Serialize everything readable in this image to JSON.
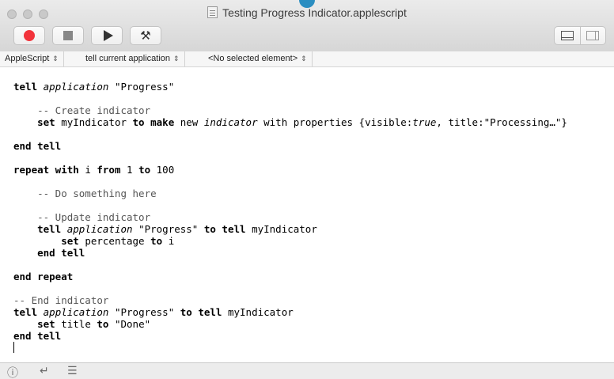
{
  "window": {
    "title": "Testing Progress Indicator.applescript"
  },
  "toolbar": {
    "record": "record",
    "stop": "stop",
    "run": "run",
    "compile": "compile",
    "show_bottom_pane": "show-bottom-pane",
    "show_right_pane": "show-right-pane"
  },
  "navbar": {
    "language": "AppleScript",
    "target": "tell current application",
    "element": "<No selected element>"
  },
  "code": {
    "lines": [
      [
        [
          "kw",
          "tell"
        ],
        [
          "t",
          " "
        ],
        [
          "app",
          "application"
        ],
        [
          "t",
          " \"Progress\""
        ]
      ],
      [],
      [
        [
          "cm",
          "    -- Create indicator"
        ]
      ],
      [
        [
          "t",
          "    "
        ],
        [
          "kw",
          "set"
        ],
        [
          "t",
          " myIndicator "
        ],
        [
          "kw",
          "to"
        ],
        [
          "t",
          " "
        ],
        [
          "kw",
          "make"
        ],
        [
          "t",
          " new "
        ],
        [
          "app",
          "indicator"
        ],
        [
          "t",
          " with properties {visible:"
        ],
        [
          "app",
          "true"
        ],
        [
          "t",
          ", title:\"Processing…\"}"
        ]
      ],
      [],
      [
        [
          "kw",
          "end tell"
        ]
      ],
      [],
      [
        [
          "kw",
          "repeat with"
        ],
        [
          "t",
          " i "
        ],
        [
          "kw",
          "from"
        ],
        [
          "t",
          " 1 "
        ],
        [
          "kw",
          "to"
        ],
        [
          "t",
          " 100"
        ]
      ],
      [],
      [
        [
          "cm",
          "    -- Do something here"
        ]
      ],
      [],
      [
        [
          "cm",
          "    -- Update indicator"
        ]
      ],
      [
        [
          "t",
          "    "
        ],
        [
          "kw",
          "tell"
        ],
        [
          "t",
          " "
        ],
        [
          "app",
          "application"
        ],
        [
          "t",
          " \"Progress\" "
        ],
        [
          "kw",
          "to tell"
        ],
        [
          "t",
          " myIndicator"
        ]
      ],
      [
        [
          "t",
          "        "
        ],
        [
          "kw",
          "set"
        ],
        [
          "t",
          " percentage "
        ],
        [
          "kw",
          "to"
        ],
        [
          "t",
          " i"
        ]
      ],
      [
        [
          "t",
          "    "
        ],
        [
          "kw",
          "end tell"
        ]
      ],
      [],
      [
        [
          "kw",
          "end repeat"
        ]
      ],
      [],
      [
        [
          "cm",
          "-- End indicator"
        ]
      ],
      [
        [
          "kw",
          "tell"
        ],
        [
          "t",
          " "
        ],
        [
          "app",
          "application"
        ],
        [
          "t",
          " \"Progress\" "
        ],
        [
          "kw",
          "to tell"
        ],
        [
          "t",
          " myIndicator"
        ]
      ],
      [
        [
          "t",
          "    "
        ],
        [
          "kw",
          "set"
        ],
        [
          "t",
          " title "
        ],
        [
          "kw",
          "to"
        ],
        [
          "t",
          " \"Done\""
        ]
      ],
      [
        [
          "kw",
          "end tell"
        ]
      ],
      [
        [
          "caret",
          ""
        ]
      ]
    ]
  },
  "statusbar": {
    "info": "info-icon",
    "return": "return-icon",
    "list": "list-icon"
  },
  "colors": {
    "record": "#f2333b",
    "accent_dot": "#2b8ec1"
  }
}
